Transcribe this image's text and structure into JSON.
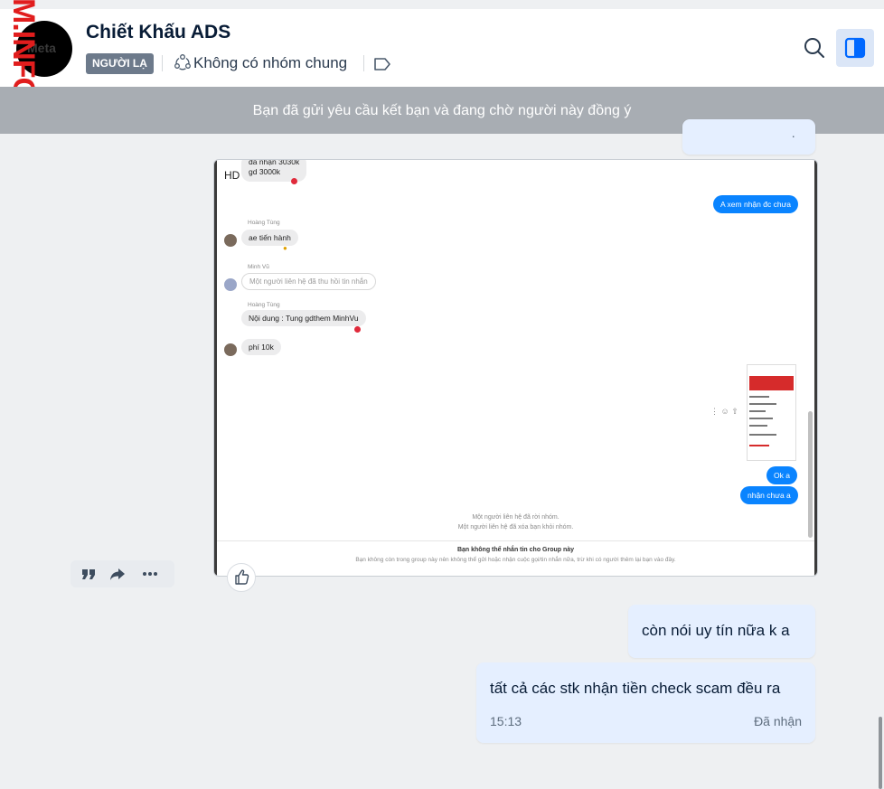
{
  "header": {
    "title": "Chiết Khấu ADS",
    "badge": "NGƯỜI LẠ",
    "group_text": "Không có nhóm chung",
    "avatar_logo": "Meta",
    "watermark": "M.INFO"
  },
  "banner": {
    "text": "Bạn đã gửi yêu cầu kết bạn và đang chờ người này đồng ý"
  },
  "screenshot": {
    "top_bubble_1": "đã nhận 3030k",
    "top_bubble_2": "gd 3000k",
    "hd_label": "HD",
    "out_1": "A xem nhận đc chưa",
    "name_1": "Hoàng Tùng",
    "bubble_1": "ae tiến hành",
    "name_2": "Minh Vũ",
    "retracted": "Một người liên hệ đã thu hồi tin nhắn",
    "name_3": "Hoàng Tùng",
    "bubble_2": "Nội dung : Tung gdthem MinhVu",
    "bubble_3": "phí 10k",
    "out_2": "Ok a",
    "out_3": "nhận chưa a",
    "sys_1": "Một người liên hệ đã rời nhóm.",
    "sys_2": "Một người liên hệ đã xóa bạn khỏi nhóm.",
    "footer_title": "Bạn không thể nhắn tin cho Group này",
    "footer_sub": "Bạn không còn trong group này nên không thể gửi hoặc nhận cuộc gọi/tin nhắn nữa, trừ khi có người thêm lại bạn vào đây."
  },
  "messages": [
    {
      "text": "còn nói uy tín nữa k a"
    },
    {
      "text": "tất cả các stk nhận tiền check scam đều ra",
      "time": "15:13",
      "status": "Đã nhận"
    }
  ],
  "icons": [
    "search-icon",
    "sidebar-toggle-icon",
    "group-icon",
    "tag-icon",
    "quote-icon",
    "forward-icon",
    "more-icon",
    "like-icon"
  ],
  "colors": {
    "accent": "#0068ff",
    "bubble": "#e5efff",
    "banner": "#a8adb3",
    "badge": "#6d7a8b"
  }
}
